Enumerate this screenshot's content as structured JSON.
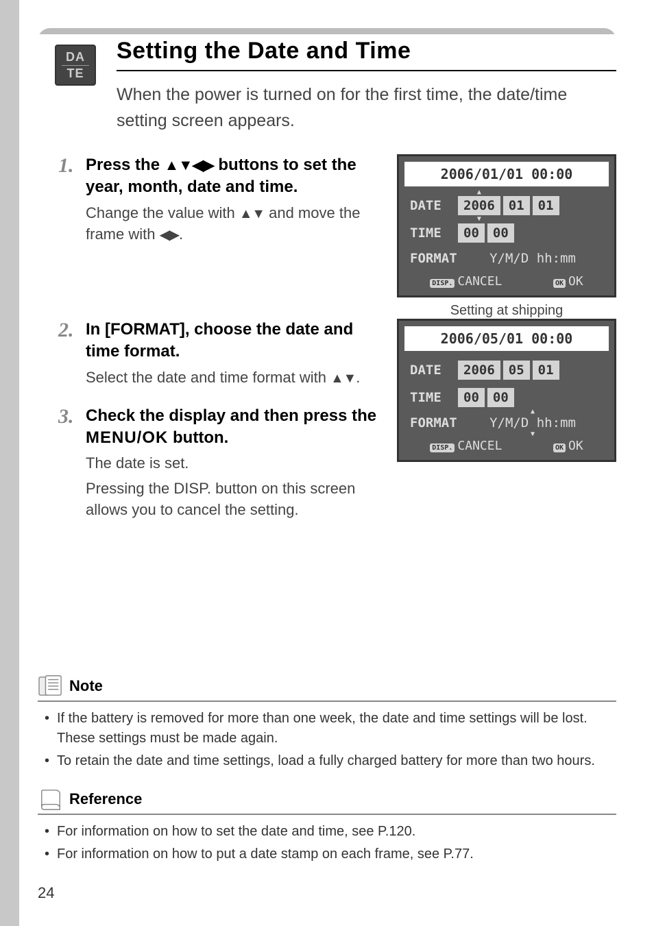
{
  "icon": {
    "line1": "DA",
    "line2": "TE"
  },
  "title": "Setting the Date and Time",
  "intro": "When the power is turned on for the first time, the date/time setting screen appears.",
  "steps": [
    {
      "num": "1",
      "title_pre": "Press the ",
      "title_post": " buttons to set the year, month, date and time.",
      "arrows": "▲▼◀▶",
      "text_pre": "Change the value with ",
      "text_mid_arrows": "▲▼",
      "text_mid": " and move the frame with ",
      "text_end_arrows": "◀▶",
      "text_end": "."
    },
    {
      "num": "2",
      "title": "In [FORMAT], choose the date and time format.",
      "text_pre": "Select the date and time format with ",
      "text_arrows": "▲▼",
      "text_end": "."
    },
    {
      "num": "3",
      "title_pre": "Check the display and then press the ",
      "title_btn": "MENU/OK",
      "title_post": " button.",
      "text1": "The date is set.",
      "text2": "Pressing the DISP. button on this screen allows you to cancel the setting."
    }
  ],
  "lcd1": {
    "header": "2006/01/01 00:00",
    "date_label": "DATE",
    "date_y": "2006",
    "date_m": "01",
    "date_d": "01",
    "time_label": "TIME",
    "time_h": "00",
    "time_m": "00",
    "format_label": "FORMAT",
    "format_val": "Y/M/D hh:mm",
    "cancel_tag": "DISP.",
    "cancel": "CANCEL",
    "ok_tag": "OK",
    "ok": "OK",
    "caption": "Setting at shipping"
  },
  "lcd2": {
    "header": "2006/05/01 00:00",
    "date_label": "DATE",
    "date_y": "2006",
    "date_m": "05",
    "date_d": "01",
    "time_label": "TIME",
    "time_h": "00",
    "time_m": "00",
    "format_label": "FORMAT",
    "format_val": "Y/M/D hh:mm",
    "cancel_tag": "DISP.",
    "cancel": "CANCEL",
    "ok_tag": "OK",
    "ok": "OK"
  },
  "note": {
    "title": "Note",
    "items": [
      "If the battery is removed for more than one week, the date and time settings will be lost. These settings must be made again.",
      "To retain the date and time settings, load a fully charged battery for more than two hours."
    ]
  },
  "reference": {
    "title": "Reference",
    "items": [
      "For information on how to set the date and time, see P.120.",
      "For information on how to put a date stamp on each frame, see P.77."
    ]
  },
  "page_number": "24"
}
